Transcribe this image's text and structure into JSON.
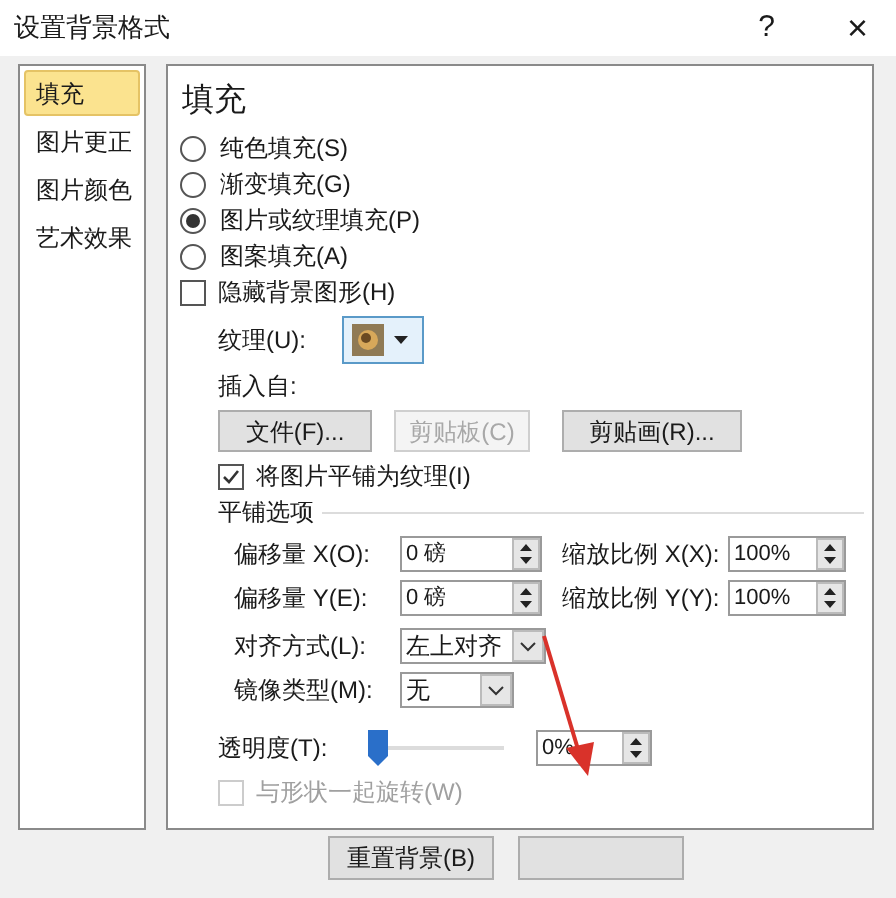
{
  "window": {
    "title": "设置背景格式",
    "help": "?",
    "close": "×"
  },
  "nav": [
    {
      "label": "填充",
      "selected": true
    },
    {
      "label": "图片更正",
      "selected": false
    },
    {
      "label": "图片颜色",
      "selected": false
    },
    {
      "label": "艺术效果",
      "selected": false
    }
  ],
  "section_title": "填充",
  "fill_options": [
    {
      "label": "纯色填充(S)",
      "selected": false
    },
    {
      "label": "渐变填充(G)",
      "selected": false
    },
    {
      "label": "图片或纹理填充(P)",
      "selected": true
    },
    {
      "label": "图案填充(A)",
      "selected": false
    }
  ],
  "hide_background": {
    "label": "隐藏背景图形(H)",
    "checked": false
  },
  "texture": {
    "label": "纹理(U):"
  },
  "insert_from": {
    "label": "插入自:",
    "buttons": [
      {
        "label": "文件(F)...",
        "disabled": false
      },
      {
        "label": "剪贴板(C)",
        "disabled": true
      },
      {
        "label": "剪贴画(R)...",
        "disabled": false
      }
    ]
  },
  "tile_as_texture": {
    "label": "将图片平铺为纹理(I)",
    "checked": true
  },
  "tiling": {
    "title": "平铺选项",
    "fields": [
      {
        "label": "偏移量 X(O):",
        "value": "0 磅"
      },
      {
        "label": "缩放比例 X(X):",
        "value": "100%"
      },
      {
        "label": "偏移量 Y(E):",
        "value": "0 磅"
      },
      {
        "label": "缩放比例 Y(Y):",
        "value": "100%"
      }
    ],
    "alignment": {
      "label": "对齐方式(L):",
      "value": "左上对齐"
    },
    "mirror": {
      "label": "镜像类型(M):",
      "value": "无"
    }
  },
  "transparency": {
    "label": "透明度(T):",
    "level": 0.0,
    "value": "0%"
  },
  "rotate_with_shape": {
    "label": "与形状一起旋转(W)",
    "checked": false,
    "disabled": true
  },
  "footer_buttons": [
    {
      "label": "重置背景(B)"
    }
  ]
}
